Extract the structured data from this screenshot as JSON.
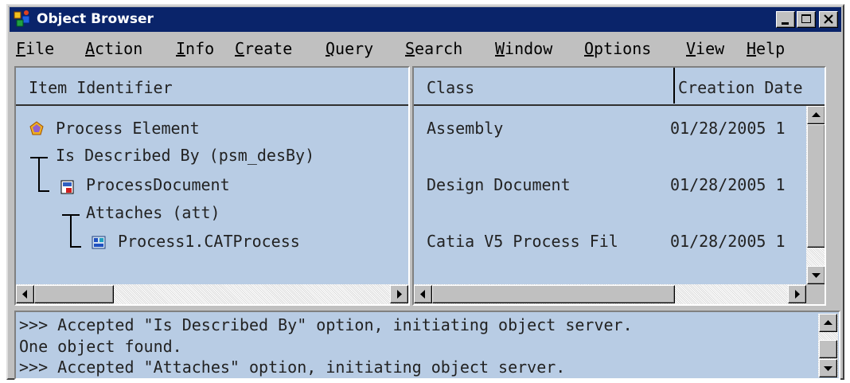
{
  "window": {
    "title": "Object Browser"
  },
  "menu": [
    {
      "ul": "F",
      "rest": "ile"
    },
    {
      "ul": "A",
      "rest": "ction"
    },
    {
      "ul": "I",
      "rest": "nfo"
    },
    {
      "ul": "C",
      "rest": "reate"
    },
    {
      "ul": "Q",
      "rest": "uery"
    },
    {
      "ul": "S",
      "rest": "earch"
    },
    {
      "ul": "W",
      "rest": "indow"
    },
    {
      "ul": "O",
      "rest": "ptions"
    },
    {
      "ul": "V",
      "rest": "iew"
    },
    {
      "ul": "H",
      "rest": "elp"
    }
  ],
  "columns": {
    "item_identifier": "Item Identifier",
    "class": "Class",
    "creation_date": "Creation Date"
  },
  "tree": {
    "process_element": "Process Element",
    "is_described_by": "Is Described By (psm_desBy)",
    "process_document": "ProcessDocument",
    "attaches": "Attaches (att)",
    "process1": "Process1.CATProcess"
  },
  "rows": {
    "r1_class": "Assembly",
    "r1_date": "01/28/2005 1",
    "r2_class": "Design Document",
    "r2_date": "01/28/2005 1",
    "r3_class": "Catia V5 Process Fil",
    "r3_date": "01/28/2005 1"
  },
  "log": [
    ">>> Accepted \"Is Described By\" option, initiating object server.",
    "One object found.",
    ">>> Accepted \"Attaches\" option, initiating object server."
  ],
  "icons": {
    "app": "object-browser-icon",
    "process_element": "process-element-icon",
    "document": "document-icon",
    "catprocess": "catprocess-icon"
  }
}
